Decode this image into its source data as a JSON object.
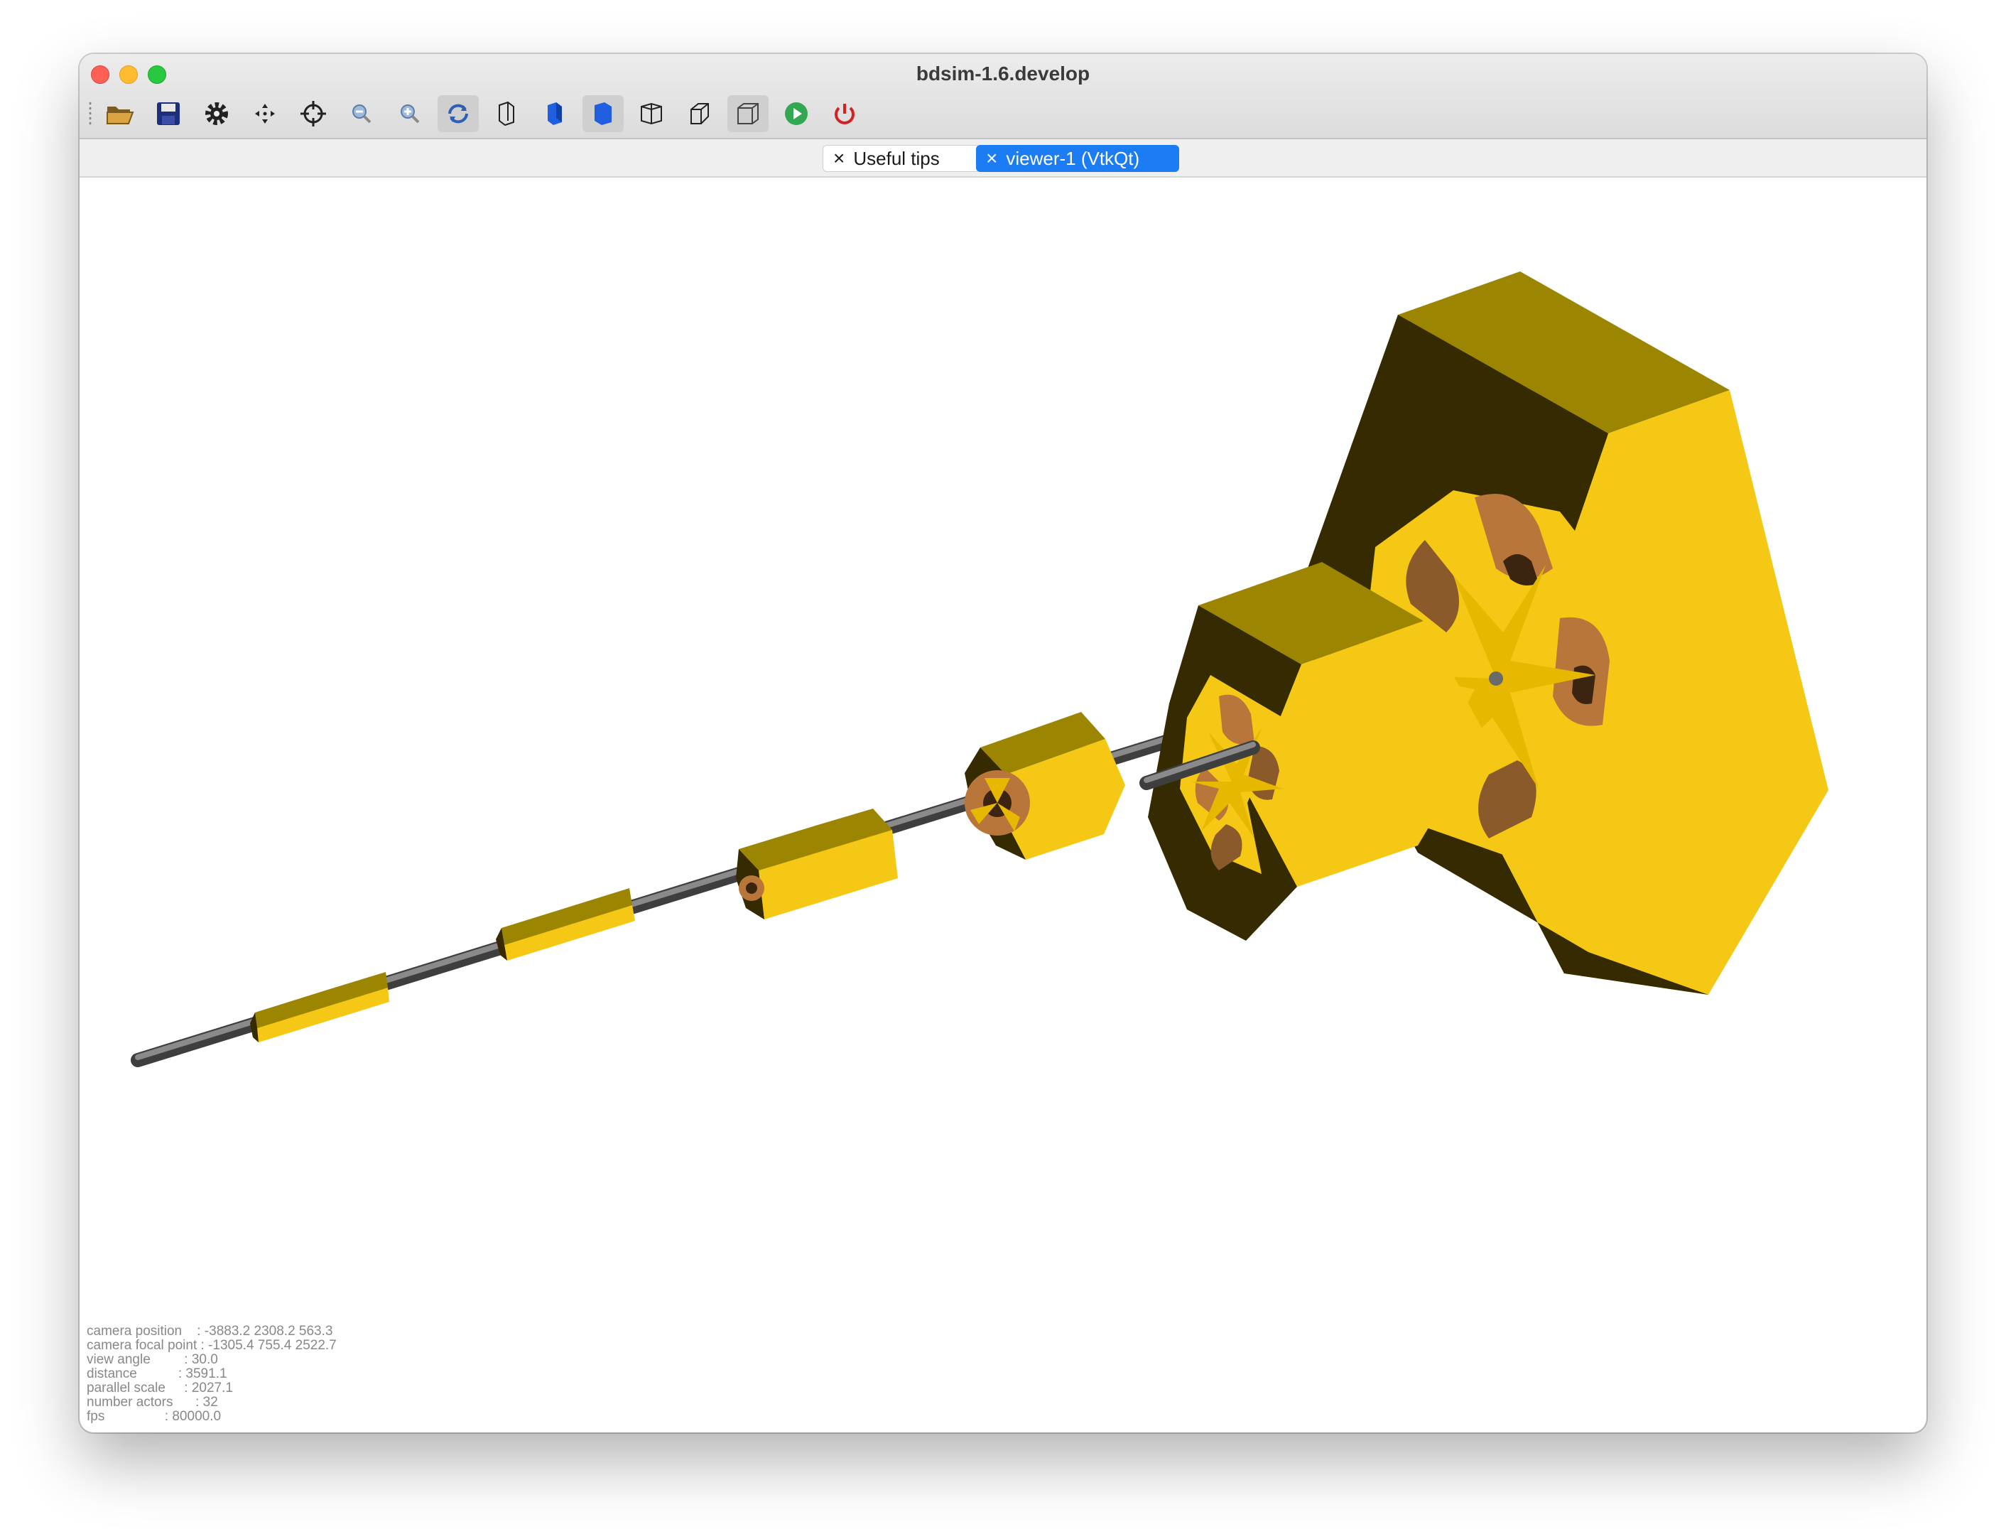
{
  "window": {
    "title": "bdsim-1.6.develop"
  },
  "toolbar": {
    "tools": [
      {
        "name": "open-folder-icon"
      },
      {
        "name": "save-icon"
      },
      {
        "name": "settings-gear-icon"
      },
      {
        "name": "move-icon"
      },
      {
        "name": "pick-target-icon"
      },
      {
        "name": "zoom-out-icon"
      },
      {
        "name": "zoom-in-icon"
      },
      {
        "name": "rotate-icon",
        "pressed": true
      },
      {
        "name": "hidden-line-icon"
      },
      {
        "name": "solid-icon"
      },
      {
        "name": "surface-icon",
        "pressed": true
      },
      {
        "name": "wireframe-icon"
      },
      {
        "name": "perspective-icon"
      },
      {
        "name": "ortho-icon",
        "pressed": true
      },
      {
        "name": "run-icon"
      },
      {
        "name": "quit-icon"
      }
    ]
  },
  "tabs": [
    {
      "label": "Useful tips",
      "active": false
    },
    {
      "label": "viewer-1 (VtkQt)",
      "active": true
    }
  ],
  "colors": {
    "magnet_top": "#9c8500",
    "magnet_front": "#f4c814",
    "magnet_side": "#352a00",
    "beampipe": "#6a6a6a",
    "coil": "#b8763a",
    "coil_dark": "#3b2410",
    "accent": "#1c7cf4"
  },
  "camera_info": {
    "rows": [
      {
        "label": "camera position    ",
        "value": ": -3883.2 2308.2 563.3"
      },
      {
        "label": "camera focal point ",
        "value": ": -1305.4 755.4 2522.7"
      },
      {
        "label": "view angle         ",
        "value": ": 30.0"
      },
      {
        "label": "distance           ",
        "value": ": 3591.1"
      },
      {
        "label": "parallel scale     ",
        "value": ": 2027.1"
      },
      {
        "label": "number actors      ",
        "value": ": 32"
      },
      {
        "label": "fps                ",
        "value": ": 80000.0"
      }
    ]
  }
}
